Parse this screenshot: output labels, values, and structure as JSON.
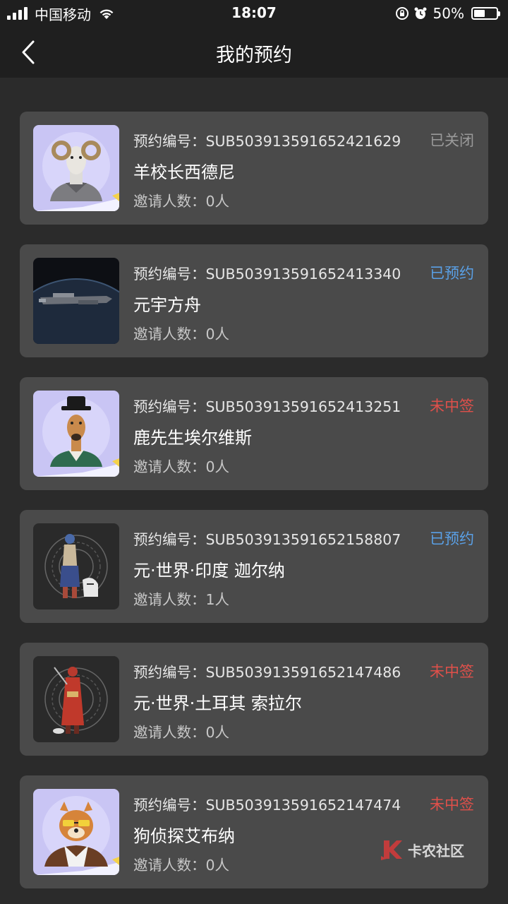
{
  "status_bar": {
    "carrier": "中国移动",
    "time": "18:07",
    "battery": "50%",
    "battery_level": 0.5
  },
  "nav": {
    "title": "我的预约",
    "back_icon": "chevron-left-icon"
  },
  "colors": {
    "closed": "#9a9a9a",
    "booked": "#5aa0e6",
    "lost": "#e0504a"
  },
  "reservations": [
    {
      "no": "预约编号：SUB503913591652421629",
      "status": "已关闭",
      "status_type": "closed",
      "name": "羊校长西德尼",
      "invite": "邀请人数：0人",
      "thumb": "ram-avatar"
    },
    {
      "no": "预约编号：SUB503913591652413340",
      "status": "已预约",
      "status_type": "booked",
      "name": "元宇方舟",
      "invite": "邀请人数：0人",
      "thumb": "spaceship-image"
    },
    {
      "no": "预约编号：SUB503913591652413251",
      "status": "未中签",
      "status_type": "lost",
      "name": "鹿先生埃尔维斯",
      "invite": "邀请人数：0人",
      "thumb": "deer-avatar"
    },
    {
      "no": "预约编号：SUB503913591652158807",
      "status": "已预约",
      "status_type": "booked",
      "name": "元·世界·印度 迦尔纳",
      "invite": "邀请人数：1人",
      "thumb": "warrior-figure"
    },
    {
      "no": "预约编号：SUB503913591652147486",
      "status": "未中签",
      "status_type": "lost",
      "name": "元·世界·土耳其 索拉尔",
      "invite": "邀请人数：0人",
      "thumb": "red-figure"
    },
    {
      "no": "预约编号：SUB503913591652147474",
      "status": "未中签",
      "status_type": "lost",
      "name": "狗侦探艾布纳",
      "invite": "邀请人数：0人",
      "thumb": "dog-avatar"
    }
  ],
  "watermark": {
    "text": "卡农社区"
  }
}
